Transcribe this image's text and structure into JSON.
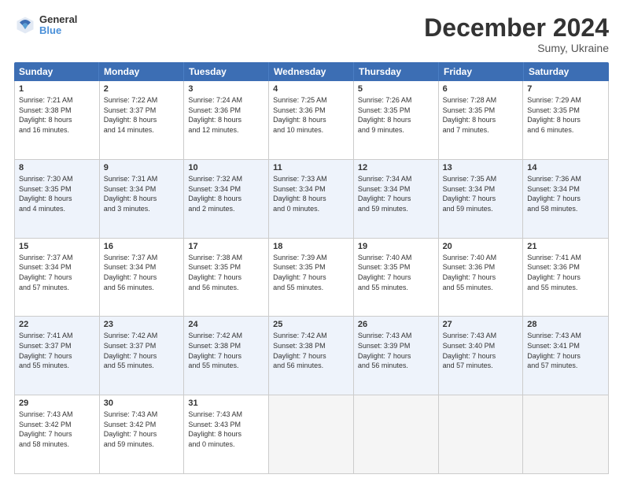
{
  "header": {
    "logo_line1": "General",
    "logo_line2": "Blue",
    "month": "December 2024",
    "location": "Sumy, Ukraine"
  },
  "days_of_week": [
    "Sunday",
    "Monday",
    "Tuesday",
    "Wednesday",
    "Thursday",
    "Friday",
    "Saturday"
  ],
  "weeks": [
    [
      {
        "num": "1",
        "lines": [
          "Sunrise: 7:21 AM",
          "Sunset: 3:38 PM",
          "Daylight: 8 hours",
          "and 16 minutes."
        ]
      },
      {
        "num": "2",
        "lines": [
          "Sunrise: 7:22 AM",
          "Sunset: 3:37 PM",
          "Daylight: 8 hours",
          "and 14 minutes."
        ]
      },
      {
        "num": "3",
        "lines": [
          "Sunrise: 7:24 AM",
          "Sunset: 3:36 PM",
          "Daylight: 8 hours",
          "and 12 minutes."
        ]
      },
      {
        "num": "4",
        "lines": [
          "Sunrise: 7:25 AM",
          "Sunset: 3:36 PM",
          "Daylight: 8 hours",
          "and 10 minutes."
        ]
      },
      {
        "num": "5",
        "lines": [
          "Sunrise: 7:26 AM",
          "Sunset: 3:35 PM",
          "Daylight: 8 hours",
          "and 9 minutes."
        ]
      },
      {
        "num": "6",
        "lines": [
          "Sunrise: 7:28 AM",
          "Sunset: 3:35 PM",
          "Daylight: 8 hours",
          "and 7 minutes."
        ]
      },
      {
        "num": "7",
        "lines": [
          "Sunrise: 7:29 AM",
          "Sunset: 3:35 PM",
          "Daylight: 8 hours",
          "and 6 minutes."
        ]
      }
    ],
    [
      {
        "num": "8",
        "lines": [
          "Sunrise: 7:30 AM",
          "Sunset: 3:35 PM",
          "Daylight: 8 hours",
          "and 4 minutes."
        ]
      },
      {
        "num": "9",
        "lines": [
          "Sunrise: 7:31 AM",
          "Sunset: 3:34 PM",
          "Daylight: 8 hours",
          "and 3 minutes."
        ]
      },
      {
        "num": "10",
        "lines": [
          "Sunrise: 7:32 AM",
          "Sunset: 3:34 PM",
          "Daylight: 8 hours",
          "and 2 minutes."
        ]
      },
      {
        "num": "11",
        "lines": [
          "Sunrise: 7:33 AM",
          "Sunset: 3:34 PM",
          "Daylight: 8 hours",
          "and 0 minutes."
        ]
      },
      {
        "num": "12",
        "lines": [
          "Sunrise: 7:34 AM",
          "Sunset: 3:34 PM",
          "Daylight: 7 hours",
          "and 59 minutes."
        ]
      },
      {
        "num": "13",
        "lines": [
          "Sunrise: 7:35 AM",
          "Sunset: 3:34 PM",
          "Daylight: 7 hours",
          "and 59 minutes."
        ]
      },
      {
        "num": "14",
        "lines": [
          "Sunrise: 7:36 AM",
          "Sunset: 3:34 PM",
          "Daylight: 7 hours",
          "and 58 minutes."
        ]
      }
    ],
    [
      {
        "num": "15",
        "lines": [
          "Sunrise: 7:37 AM",
          "Sunset: 3:34 PM",
          "Daylight: 7 hours",
          "and 57 minutes."
        ]
      },
      {
        "num": "16",
        "lines": [
          "Sunrise: 7:37 AM",
          "Sunset: 3:34 PM",
          "Daylight: 7 hours",
          "and 56 minutes."
        ]
      },
      {
        "num": "17",
        "lines": [
          "Sunrise: 7:38 AM",
          "Sunset: 3:35 PM",
          "Daylight: 7 hours",
          "and 56 minutes."
        ]
      },
      {
        "num": "18",
        "lines": [
          "Sunrise: 7:39 AM",
          "Sunset: 3:35 PM",
          "Daylight: 7 hours",
          "and 55 minutes."
        ]
      },
      {
        "num": "19",
        "lines": [
          "Sunrise: 7:40 AM",
          "Sunset: 3:35 PM",
          "Daylight: 7 hours",
          "and 55 minutes."
        ]
      },
      {
        "num": "20",
        "lines": [
          "Sunrise: 7:40 AM",
          "Sunset: 3:36 PM",
          "Daylight: 7 hours",
          "and 55 minutes."
        ]
      },
      {
        "num": "21",
        "lines": [
          "Sunrise: 7:41 AM",
          "Sunset: 3:36 PM",
          "Daylight: 7 hours",
          "and 55 minutes."
        ]
      }
    ],
    [
      {
        "num": "22",
        "lines": [
          "Sunrise: 7:41 AM",
          "Sunset: 3:37 PM",
          "Daylight: 7 hours",
          "and 55 minutes."
        ]
      },
      {
        "num": "23",
        "lines": [
          "Sunrise: 7:42 AM",
          "Sunset: 3:37 PM",
          "Daylight: 7 hours",
          "and 55 minutes."
        ]
      },
      {
        "num": "24",
        "lines": [
          "Sunrise: 7:42 AM",
          "Sunset: 3:38 PM",
          "Daylight: 7 hours",
          "and 55 minutes."
        ]
      },
      {
        "num": "25",
        "lines": [
          "Sunrise: 7:42 AM",
          "Sunset: 3:38 PM",
          "Daylight: 7 hours",
          "and 56 minutes."
        ]
      },
      {
        "num": "26",
        "lines": [
          "Sunrise: 7:43 AM",
          "Sunset: 3:39 PM",
          "Daylight: 7 hours",
          "and 56 minutes."
        ]
      },
      {
        "num": "27",
        "lines": [
          "Sunrise: 7:43 AM",
          "Sunset: 3:40 PM",
          "Daylight: 7 hours",
          "and 57 minutes."
        ]
      },
      {
        "num": "28",
        "lines": [
          "Sunrise: 7:43 AM",
          "Sunset: 3:41 PM",
          "Daylight: 7 hours",
          "and 57 minutes."
        ]
      }
    ],
    [
      {
        "num": "29",
        "lines": [
          "Sunrise: 7:43 AM",
          "Sunset: 3:42 PM",
          "Daylight: 7 hours",
          "and 58 minutes."
        ]
      },
      {
        "num": "30",
        "lines": [
          "Sunrise: 7:43 AM",
          "Sunset: 3:42 PM",
          "Daylight: 7 hours",
          "and 59 minutes."
        ]
      },
      {
        "num": "31",
        "lines": [
          "Sunrise: 7:43 AM",
          "Sunset: 3:43 PM",
          "Daylight: 8 hours",
          "and 0 minutes."
        ]
      },
      {
        "num": "",
        "lines": []
      },
      {
        "num": "",
        "lines": []
      },
      {
        "num": "",
        "lines": []
      },
      {
        "num": "",
        "lines": []
      }
    ]
  ]
}
